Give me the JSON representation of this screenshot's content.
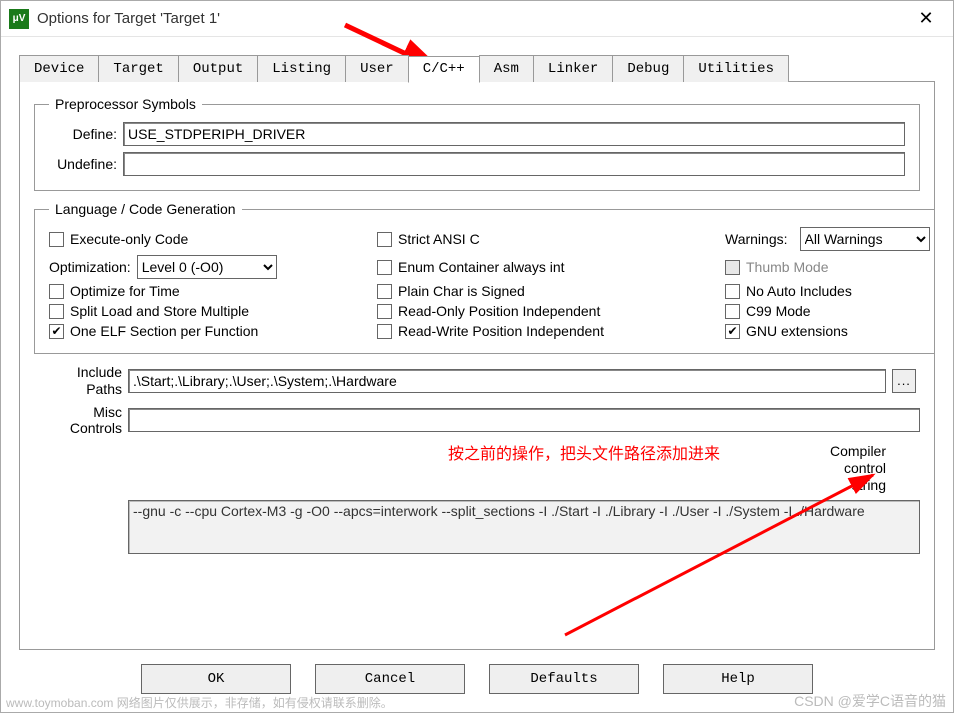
{
  "title": "Options for Target 'Target 1'",
  "tabs": [
    "Device",
    "Target",
    "Output",
    "Listing",
    "User",
    "C/C++",
    "Asm",
    "Linker",
    "Debug",
    "Utilities"
  ],
  "active_tab": "C/C++",
  "preproc": {
    "legend": "Preprocessor Symbols",
    "define_label": "Define:",
    "define_value": "USE_STDPERIPH_DRIVER",
    "undefine_label": "Undefine:",
    "undefine_value": ""
  },
  "lang": {
    "legend": "Language / Code Generation",
    "exec_only": "Execute-only Code",
    "optimization_label": "Optimization:",
    "optimization_value": "Level 0 (-O0)",
    "opt_time": "Optimize for Time",
    "split_load": "Split Load and Store Multiple",
    "one_elf": "One ELF Section per Function",
    "strict_ansi": "Strict ANSI C",
    "enum_container": "Enum Container always int",
    "plain_char": "Plain Char is Signed",
    "readonly_pi": "Read-Only Position Independent",
    "readwrite_pi": "Read-Write Position Independent",
    "warnings_label": "Warnings:",
    "warnings_value": "All Warnings",
    "thumb_mode": "Thumb Mode",
    "no_auto": "No Auto Includes",
    "c99": "C99 Mode",
    "gnu_ext": "GNU extensions"
  },
  "paths": {
    "include_label": "Include\nPaths",
    "include_value": ".\\Start;.\\Library;.\\User;.\\System;.\\Hardware",
    "misc_label": "Misc\nControls",
    "misc_value": "",
    "compiler_label": "Compiler\ncontrol\nstring",
    "compiler_value": "--gnu -c --cpu Cortex-M3 -g -O0 --apcs=interwork --split_sections -I ./Start -I ./Library -I ./User -I ./System -I ./Hardware"
  },
  "buttons": {
    "ok": "OK",
    "cancel": "Cancel",
    "defaults": "Defaults",
    "help": "Help"
  },
  "annotation": "按之前的操作，把头文件路径添加进来",
  "watermark_bl": "www.toymoban.com 网络图片仅供展示，非存储，如有侵权请联系删除。",
  "watermark_br": "CSDN @爱学C语音的猫"
}
